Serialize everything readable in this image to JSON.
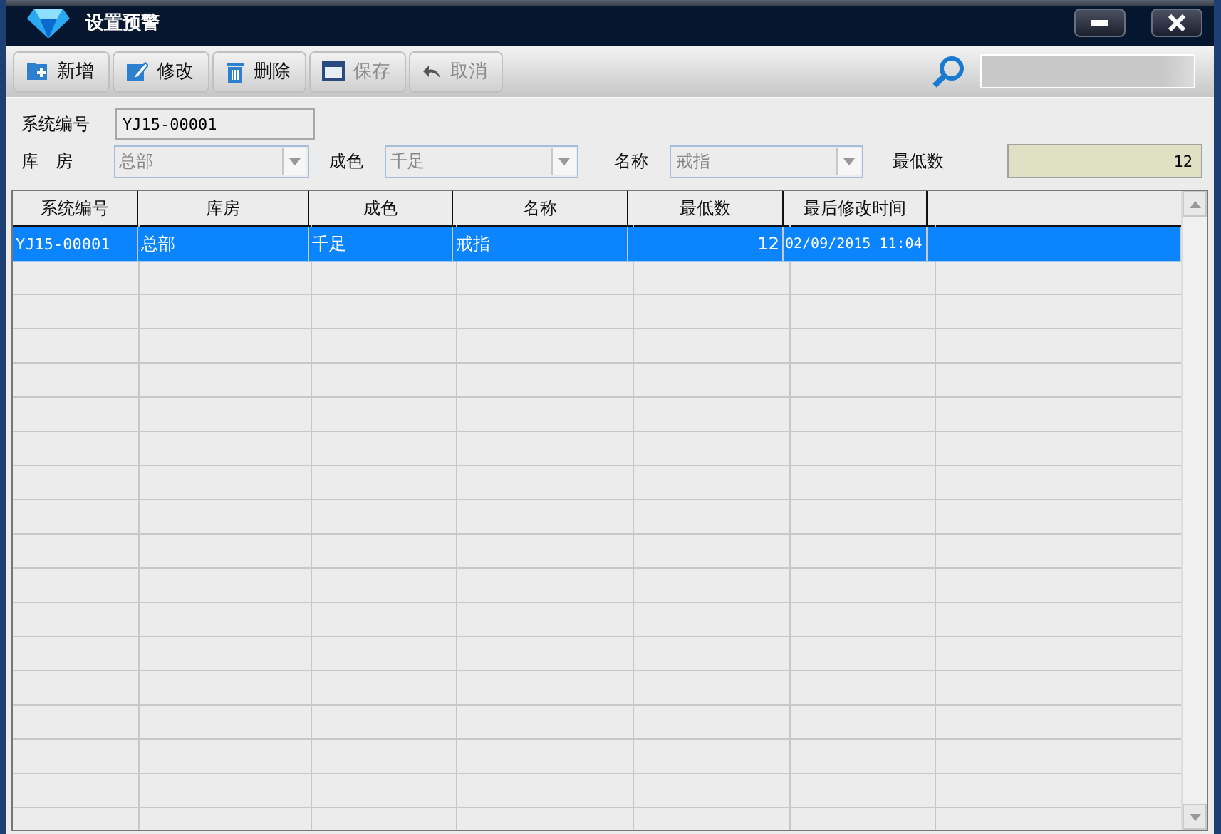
{
  "window": {
    "title": "设置预警"
  },
  "toolbar": {
    "buttons": [
      {
        "label": "新增",
        "kind": "add",
        "disabled": false
      },
      {
        "label": "修改",
        "kind": "edit",
        "disabled": false
      },
      {
        "label": "删除",
        "kind": "delete",
        "disabled": false
      },
      {
        "label": "保存",
        "kind": "save",
        "disabled": true
      },
      {
        "label": "取消",
        "kind": "undo",
        "disabled": true
      }
    ]
  },
  "form": {
    "code": {
      "label": "系统编号",
      "value": "YJ15-00001"
    },
    "filters": [
      {
        "label": "库　房",
        "value": "总部",
        "kind": "combo",
        "disabled": true
      },
      {
        "label": "成色",
        "value": "千足",
        "kind": "combo",
        "disabled": true
      },
      {
        "label": "名称",
        "value": "戒指",
        "kind": "combo",
        "disabled": true
      },
      {
        "label": "最低数",
        "value": "12",
        "kind": "number"
      }
    ]
  },
  "table": {
    "columns": [
      "系统编号",
      "库房",
      "成色",
      "名称",
      "最低数",
      "最后修改时间"
    ],
    "rows": [
      {
        "cells": [
          "YJ15-00001",
          "总部",
          "千足",
          "戒指",
          "12",
          "02/09/2015 11:04"
        ],
        "selected": true
      }
    ]
  }
}
